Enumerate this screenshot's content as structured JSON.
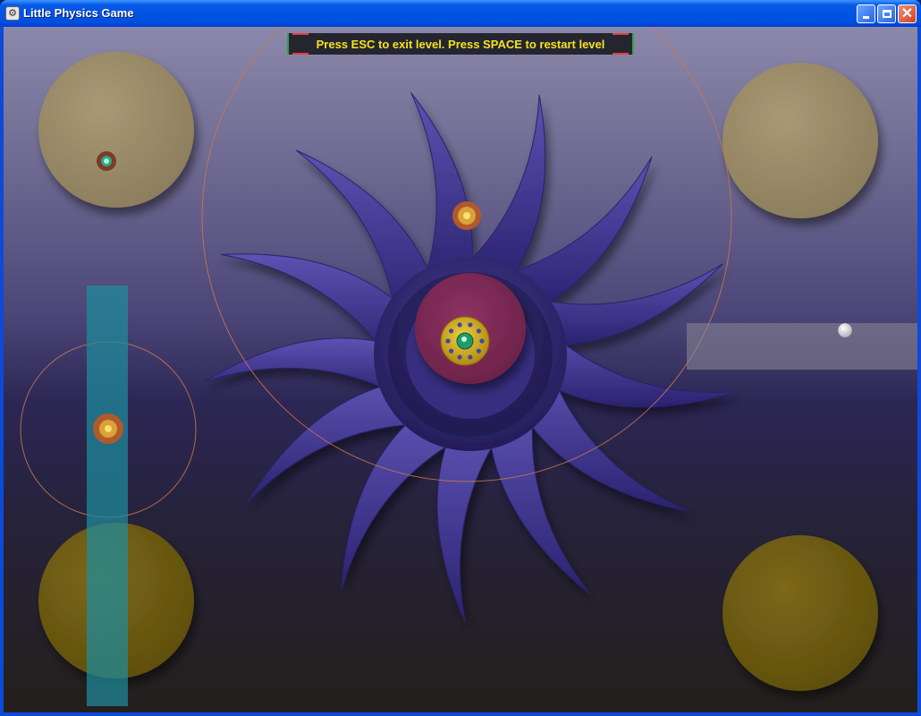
{
  "window": {
    "title": "Little Physics Game",
    "buttons": {
      "minimize": "minimize",
      "maximize": "maximize",
      "close": "close"
    }
  },
  "hud": {
    "instructions": "Press ESC to exit level. Press SPACE to restart level"
  },
  "colors": {
    "title_text": "#ffffff",
    "instructions_text": "#f4e21e",
    "tentacle": "#4a3e98",
    "core": "#7e2a52",
    "orbit_ring": "#c87850",
    "water_column": "#1f8c9c",
    "khaki_bumper": "#9a8a6a",
    "gold_bumper": "#6e5c12",
    "goal_platform": "#6c6a74"
  },
  "icons": {
    "app": "gear-icon",
    "orbiter": "spinning-disc-icon",
    "core_gem": "jeweled-disc-icon",
    "player_ball": "white-ball-icon"
  }
}
